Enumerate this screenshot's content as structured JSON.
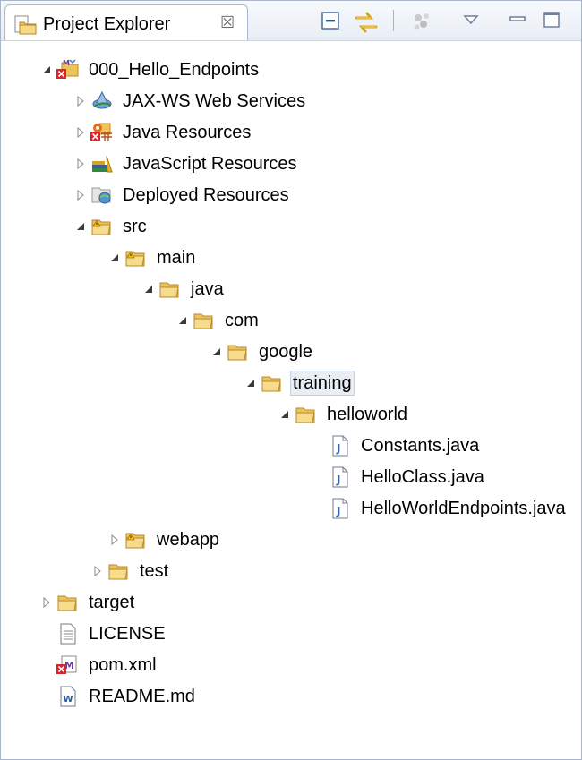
{
  "view": {
    "title": "Project Explorer",
    "close_glyph": "☒",
    "toolbar_icons": [
      "collapse-all-icon",
      "link-with-editor-icon",
      "filter-icon",
      "view-menu-icon",
      "minimize-icon",
      "maximize-icon"
    ]
  },
  "tree": [
    {
      "label": "000_Hello_Endpoints",
      "icon": "maven-project-error-icon",
      "twisty": "expanded",
      "depth": 0
    },
    {
      "label": "JAX-WS Web Services",
      "icon": "web-services-icon",
      "twisty": "collapsed",
      "depth": 1
    },
    {
      "label": "Java Resources",
      "icon": "java-resources-error-icon",
      "twisty": "collapsed",
      "depth": 1
    },
    {
      "label": "JavaScript Resources",
      "icon": "javascript-resources-icon",
      "twisty": "collapsed",
      "depth": 1
    },
    {
      "label": "Deployed Resources",
      "icon": "deployed-resources-icon",
      "twisty": "collapsed",
      "depth": 1
    },
    {
      "label": "src",
      "icon": "folder-warning-icon",
      "twisty": "expanded",
      "depth": 1
    },
    {
      "label": "main",
      "icon": "folder-warning-icon",
      "twisty": "expanded",
      "depth": 2
    },
    {
      "label": "java",
      "icon": "folder-icon",
      "twisty": "expanded",
      "depth": 3
    },
    {
      "label": "com",
      "icon": "folder-icon",
      "twisty": "expanded",
      "depth": 4
    },
    {
      "label": "google",
      "icon": "folder-icon",
      "twisty": "expanded",
      "depth": 5
    },
    {
      "label": "training",
      "icon": "folder-icon",
      "twisty": "expanded",
      "depth": 6,
      "selected": true
    },
    {
      "label": "helloworld",
      "icon": "folder-icon",
      "twisty": "expanded",
      "depth": 7
    },
    {
      "label": "Constants.java",
      "icon": "java-file-icon",
      "twisty": "none",
      "depth": 8
    },
    {
      "label": "HelloClass.java",
      "icon": "java-file-icon",
      "twisty": "none",
      "depth": 8
    },
    {
      "label": "HelloWorldEndpoints.java",
      "icon": "java-file-icon",
      "twisty": "none",
      "depth": 8
    },
    {
      "label": "webapp",
      "icon": "folder-warning-icon",
      "twisty": "collapsed",
      "depth": 2
    },
    {
      "label": "test",
      "icon": "folder-icon",
      "twisty": "collapsed",
      "depth": 1.5
    },
    {
      "label": "target",
      "icon": "folder-icon",
      "twisty": "collapsed",
      "depth": 0
    },
    {
      "label": "LICENSE",
      "icon": "text-file-icon",
      "twisty": "none",
      "depth": 0
    },
    {
      "label": "pom.xml",
      "icon": "maven-pom-error-icon",
      "twisty": "none",
      "depth": 0
    },
    {
      "label": "README.md",
      "icon": "word-file-icon",
      "twisty": "none",
      "depth": 0
    }
  ]
}
